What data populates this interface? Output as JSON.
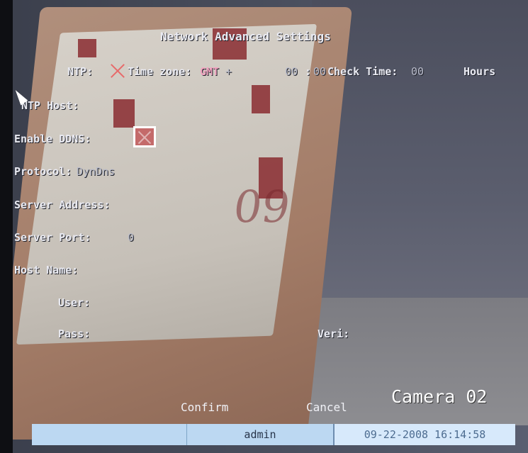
{
  "screen": {
    "title": "Network Advanced Settings",
    "ntp_row": {
      "ntp_label": "NTP:",
      "time_zone_label": "Time zone:",
      "tz_prefix": "GMT",
      "tz_sign": "+",
      "tz_hours": "00",
      "tz_colon": ":",
      "tz_minutes": "00",
      "check_time_label": "Check Time:",
      "check_time_value": "00",
      "hours_label": "Hours"
    },
    "fields": {
      "ntp_host_label": "NTP Host:",
      "enable_ddns_label": "Enable DDNS:",
      "protocol_label": "Protocol:",
      "protocol_value": "DynDns",
      "server_address_label": "Server Address:",
      "server_port_label": "Server Port:",
      "server_port_value": "0",
      "host_name_label": "Host Name:",
      "user_label": "User:",
      "pass_label": "Pass:",
      "veri_label": "Veri:"
    },
    "buttons": {
      "confirm": "Confirm",
      "cancel": "Cancel"
    },
    "camera_label": "Camera 02"
  },
  "status_bar": {
    "user": "admin",
    "datetime": "09-22-2008 16:14:58"
  },
  "colors": {
    "text": "#e9eaf2",
    "value_text": "#b9bccb",
    "accent_pink": "#f2a3c0",
    "cross_red": "#e76a6a",
    "status_bar_blue": "#bcd8f2"
  },
  "icons": {
    "ntp_toggle": "cross-icon",
    "ddns_checkbox": "checked-box-icon",
    "pointer": "mouse-cursor-icon"
  }
}
